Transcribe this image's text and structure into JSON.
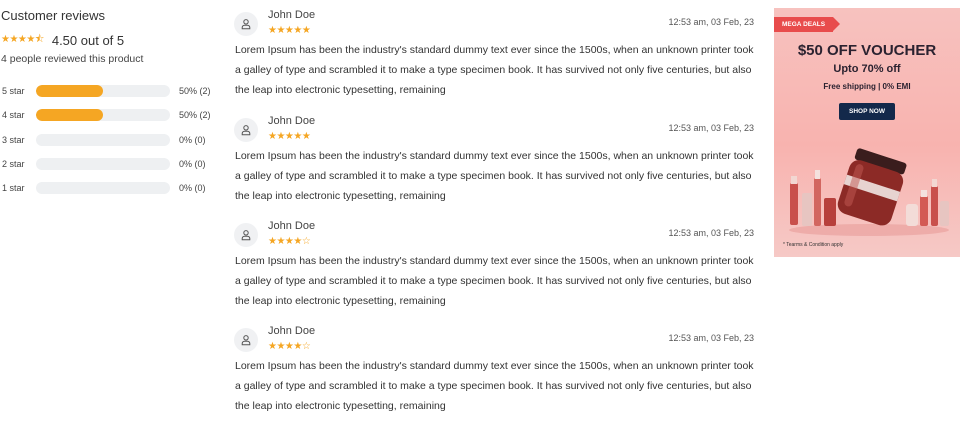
{
  "summary": {
    "title": "Customer reviews",
    "average_stars": "★★★★⯪",
    "average_text": "4.50 out of 5",
    "count_text": "4 people reviewed this product",
    "rows": [
      {
        "label": "5 star",
        "percent": 50,
        "pct_text": "50% (2)"
      },
      {
        "label": "4 star",
        "percent": 50,
        "pct_text": "50% (2)"
      },
      {
        "label": "3 star",
        "percent": 0,
        "pct_text": "0% (0)"
      },
      {
        "label": "2 star",
        "percent": 0,
        "pct_text": "0% (0)"
      },
      {
        "label": "1 star",
        "percent": 0,
        "pct_text": "0% (0)"
      }
    ]
  },
  "reviews": [
    {
      "name": "John Doe",
      "rating": 5,
      "stars": "★★★★★",
      "date": "12:53 am, 03 Feb, 23",
      "body": "Lorem Ipsum has been the industry's standard dummy text ever since the 1500s, when an unknown printer took a galley of type and scrambled it to make a type specimen book. It has survived not only five centuries, but also the leap into electronic typesetting, remaining"
    },
    {
      "name": "John Doe",
      "rating": 5,
      "stars": "★★★★★",
      "date": "12:53 am, 03 Feb, 23",
      "body": "Lorem Ipsum has been the industry's standard dummy text ever since the 1500s, when an unknown printer took a galley of type and scrambled it to make a type specimen book. It has survived not only five centuries, but also the leap into electronic typesetting, remaining"
    },
    {
      "name": "John Doe",
      "rating": 4,
      "stars": "★★★★☆",
      "date": "12:53 am, 03 Feb, 23",
      "body": "Lorem Ipsum has been the industry's standard dummy text ever since the 1500s, when an unknown printer took a galley of type and scrambled it to make a type specimen book. It has survived not only five centuries, but also the leap into electronic typesetting, remaining"
    },
    {
      "name": "John Doe",
      "rating": 4,
      "stars": "★★★★☆",
      "date": "12:53 am, 03 Feb, 23",
      "body": "Lorem Ipsum has been the industry's standard dummy text ever since the 1500s, when an unknown printer took a galley of type and scrambled it to make a type specimen book. It has survived not only five centuries, but also the leap into electronic typesetting, remaining"
    }
  ],
  "ad": {
    "tag": "MEGA DEALS",
    "headline": "$50 OFF VOUCHER",
    "subline": "Upto 70% off",
    "shipping": "Free shipping | 0% EMI",
    "button": "SHOP NOW",
    "terms": "* Tearms & Condition apply"
  },
  "colors": {
    "star": "#f5a623",
    "bar_fill": "#f5a623",
    "bar_track": "#eef0f2",
    "ad_tag": "#e84c4c",
    "ad_button": "#13294b"
  },
  "icons": {
    "avatar": "user-icon",
    "star": "star-icon"
  }
}
